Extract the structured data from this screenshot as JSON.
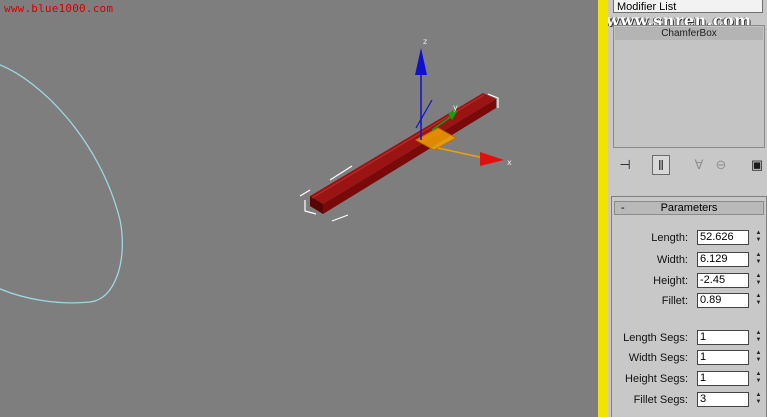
{
  "watermarks": {
    "left": "www.blue1000.com",
    "right": "www.snren.com"
  },
  "viewport": {
    "axis_labels": {
      "z": "z",
      "x": "x",
      "y": "y"
    },
    "colors": {
      "background": "#7e7e7e",
      "spline": "#9ed8e0",
      "box": "#7a0a0a",
      "z_axis": "#1010d0",
      "x_axis": "#e01010",
      "y_axis": "#10a010",
      "gizmo": "#f0a000"
    }
  },
  "panel": {
    "modifier_list_label": "Modifier List",
    "stack_items": [
      "ChamferBox"
    ],
    "toolbar_icons": [
      "pin-stack-icon",
      "show-end-result-icon",
      "make-unique-icon",
      "remove-modifier-icon",
      "configure-sets-icon"
    ],
    "rollout": {
      "collapse_glyph": "-",
      "title": "Parameters"
    },
    "parameters": [
      {
        "label": "Length:",
        "value": "52.626"
      },
      {
        "label": "Width:",
        "value": "6.129"
      },
      {
        "label": "Height:",
        "value": "-2.45"
      },
      {
        "label": "Fillet:",
        "value": "0.89"
      },
      {
        "label": "Length Segs:",
        "value": "1"
      },
      {
        "label": "Width Segs:",
        "value": "1"
      },
      {
        "label": "Height Segs:",
        "value": "1"
      },
      {
        "label": "Fillet Segs:",
        "value": "3"
      }
    ],
    "spinner_glyphs": {
      "up": "▲",
      "down": "▼"
    }
  }
}
